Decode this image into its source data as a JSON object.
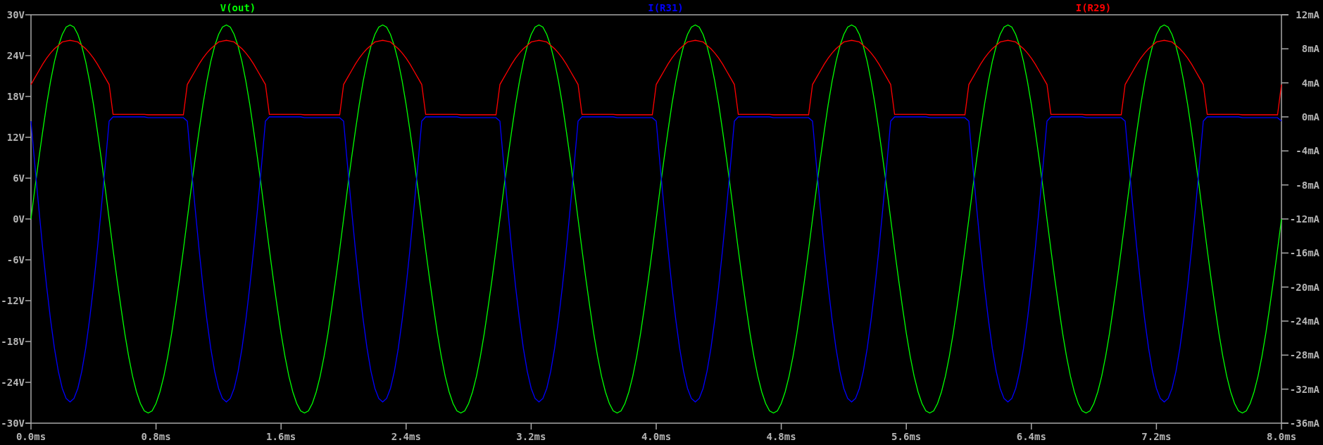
{
  "plot": {
    "chart_data": {
      "type": "line",
      "xlim": [
        0,
        8
      ],
      "ylim": [
        -30,
        30
      ],
      "y2lim": [
        -36,
        12
      ],
      "xticks": [
        {
          "value": 0,
          "label": "0.0ms"
        },
        {
          "value": 0.8,
          "label": "0.8ms"
        },
        {
          "value": 1.6,
          "label": "1.6ms"
        },
        {
          "value": 2.4,
          "label": "2.4ms"
        },
        {
          "value": 3.2,
          "label": "3.2ms"
        },
        {
          "value": 4,
          "label": "4.0ms"
        },
        {
          "value": 4.8,
          "label": "4.8ms"
        },
        {
          "value": 5.6,
          "label": "5.6ms"
        },
        {
          "value": 6.4,
          "label": "6.4ms"
        },
        {
          "value": 7.2,
          "label": "7.2ms"
        },
        {
          "value": 8,
          "label": "8.0ms"
        }
      ],
      "yticks": [
        {
          "value": 30,
          "label": "30V"
        },
        {
          "value": 24,
          "label": "24V"
        },
        {
          "value": 18,
          "label": "18V"
        },
        {
          "value": 12,
          "label": "12V"
        },
        {
          "value": 6,
          "label": "6V"
        },
        {
          "value": 0,
          "label": "0V"
        },
        {
          "value": -6,
          "label": "-6V"
        },
        {
          "value": -12,
          "label": "-12V"
        },
        {
          "value": -18,
          "label": "-18V"
        },
        {
          "value": -24,
          "label": "-24V"
        },
        {
          "value": -30,
          "label": "-30V"
        }
      ],
      "y2ticks": [
        {
          "value": 12,
          "label": "12mA"
        },
        {
          "value": 8,
          "label": "8mA"
        },
        {
          "value": 4,
          "label": "4mA"
        },
        {
          "value": 0,
          "label": "0mA"
        },
        {
          "value": -4,
          "label": "-4mA"
        },
        {
          "value": -8,
          "label": "-8mA"
        },
        {
          "value": -12,
          "label": "-12mA"
        },
        {
          "value": -16,
          "label": "-16mA"
        },
        {
          "value": -20,
          "label": "-20mA"
        },
        {
          "value": -24,
          "label": "-24mA"
        },
        {
          "value": -28,
          "label": "-28mA"
        },
        {
          "value": -32,
          "label": "-32mA"
        },
        {
          "value": -36,
          "label": "-36mA"
        }
      ],
      "x": [
        0,
        0.025,
        0.05,
        0.075,
        0.1,
        0.125,
        0.15,
        0.175,
        0.2,
        0.225,
        0.25,
        0.275,
        0.3,
        0.325,
        0.35,
        0.375,
        0.4,
        0.425,
        0.45,
        0.475,
        0.5,
        0.525,
        0.55,
        0.575,
        0.6,
        0.625,
        0.65,
        0.675,
        0.7,
        0.725,
        0.75,
        0.775,
        0.8,
        0.825,
        0.85,
        0.875,
        0.9,
        0.925,
        0.95,
        0.975,
        1,
        1.025,
        1.05,
        1.075,
        1.1,
        1.125,
        1.15,
        1.175,
        1.2,
        1.225,
        1.25,
        1.275,
        1.3,
        1.325,
        1.35,
        1.375,
        1.4,
        1.425,
        1.45,
        1.475,
        1.5,
        1.525,
        1.55,
        1.575,
        1.6,
        1.625,
        1.65,
        1.675,
        1.7,
        1.725,
        1.75,
        1.775,
        1.8,
        1.825,
        1.85,
        1.875,
        1.9,
        1.925,
        1.95,
        1.975,
        2,
        2.025,
        2.05,
        2.075,
        2.1,
        2.125,
        2.15,
        2.175,
        2.2,
        2.225,
        2.25,
        2.275,
        2.3,
        2.325,
        2.35,
        2.375,
        2.4,
        2.425,
        2.45,
        2.475,
        2.5,
        2.525,
        2.55,
        2.575,
        2.6,
        2.625,
        2.65,
        2.675,
        2.7,
        2.725,
        2.75,
        2.775,
        2.8,
        2.825,
        2.85,
        2.875,
        2.9,
        2.925,
        2.95,
        2.975,
        3,
        3.025,
        3.05,
        3.075,
        3.1,
        3.125,
        3.15,
        3.175,
        3.2,
        3.225,
        3.25,
        3.275,
        3.3,
        3.325,
        3.35,
        3.375,
        3.4,
        3.425,
        3.45,
        3.475,
        3.5,
        3.525,
        3.55,
        3.575,
        3.6,
        3.625,
        3.65,
        3.675,
        3.7,
        3.725,
        3.75,
        3.775,
        3.8,
        3.825,
        3.85,
        3.875,
        3.9,
        3.925,
        3.95,
        3.975,
        4,
        4.025,
        4.05,
        4.075,
        4.1,
        4.125,
        4.15,
        4.175,
        4.2,
        4.225,
        4.25,
        4.275,
        4.3,
        4.325,
        4.35,
        4.375,
        4.4,
        4.425,
        4.45,
        4.475,
        4.5,
        4.525,
        4.55,
        4.575,
        4.6,
        4.625,
        4.65,
        4.675,
        4.7,
        4.725,
        4.75,
        4.775,
        4.8,
        4.825,
        4.85,
        4.875,
        4.9,
        4.925,
        4.95,
        4.975,
        5,
        5.025,
        5.05,
        5.075,
        5.1,
        5.125,
        5.15,
        5.175,
        5.2,
        5.225,
        5.25,
        5.275,
        5.3,
        5.325,
        5.35,
        5.375,
        5.4,
        5.425,
        5.45,
        5.475,
        5.5,
        5.525,
        5.55,
        5.575,
        5.6,
        5.625,
        5.65,
        5.675,
        5.7,
        5.725,
        5.75,
        5.775,
        5.8,
        5.825,
        5.85,
        5.875,
        5.9,
        5.925,
        5.95,
        5.975,
        6,
        6.025,
        6.05,
        6.075,
        6.1,
        6.125,
        6.15,
        6.175,
        6.2,
        6.225,
        6.25,
        6.275,
        6.3,
        6.325,
        6.35,
        6.375,
        6.4,
        6.425,
        6.45,
        6.475,
        6.5,
        6.525,
        6.55,
        6.575,
        6.6,
        6.625,
        6.65,
        6.675,
        6.7,
        6.725,
        6.75,
        6.775,
        6.8,
        6.825,
        6.85,
        6.875,
        6.9,
        6.925,
        6.95,
        6.975,
        7,
        7.025,
        7.05,
        7.075,
        7.1,
        7.125,
        7.15,
        7.175,
        7.2,
        7.225,
        7.25,
        7.275,
        7.3,
        7.325,
        7.35,
        7.375,
        7.4,
        7.425,
        7.45,
        7.475,
        7.5,
        7.525,
        7.55,
        7.575,
        7.6,
        7.625,
        7.65,
        7.675,
        7.7,
        7.725,
        7.75,
        7.775,
        7.8,
        7.825,
        7.85,
        7.875,
        7.9,
        7.925,
        7.95,
        7.975,
        8
      ],
      "series": [
        {
          "name": "V(out)",
          "color": "#00ff00",
          "axis": "y",
          "values": [
            0,
            4.5,
            8.8,
            12.9,
            16.8,
            20.2,
            23.1,
            25.4,
            27.1,
            28.2,
            28.5,
            28.2,
            27.1,
            25.4,
            23.1,
            20.2,
            16.8,
            12.9,
            8.8,
            4.5,
            0,
            -4.5,
            -8.8,
            -12.9,
            -16.8,
            -20.2,
            -23.1,
            -25.4,
            -27.1,
            -28.2,
            -28.5,
            -28.2,
            -27.1,
            -25.4,
            -23.1,
            -20.2,
            -16.8,
            -12.9,
            -8.8,
            -4.5,
            0,
            4.5,
            8.8,
            12.9,
            16.8,
            20.2,
            23.1,
            25.4,
            27.1,
            28.2,
            28.5,
            28.2,
            27.1,
            25.4,
            23.1,
            20.2,
            16.8,
            12.9,
            8.8,
            4.5,
            0,
            -4.5,
            -8.8,
            -12.9,
            -16.8,
            -20.2,
            -23.1,
            -25.4,
            -27.1,
            -28.2,
            -28.5,
            -28.2,
            -27.1,
            -25.4,
            -23.1,
            -20.2,
            -16.8,
            -12.9,
            -8.8,
            -4.5,
            0,
            4.5,
            8.8,
            12.9,
            16.8,
            20.2,
            23.1,
            25.4,
            27.1,
            28.2,
            28.5,
            28.2,
            27.1,
            25.4,
            23.1,
            20.2,
            16.8,
            12.9,
            8.8,
            4.5,
            0,
            -4.5,
            -8.8,
            -12.9,
            -16.8,
            -20.2,
            -23.1,
            -25.4,
            -27.1,
            -28.2,
            -28.5,
            -28.2,
            -27.1,
            -25.4,
            -23.1,
            -20.2,
            -16.8,
            -12.9,
            -8.8,
            -4.5,
            0,
            4.5,
            8.8,
            12.9,
            16.8,
            20.2,
            23.1,
            25.4,
            27.1,
            28.2,
            28.5,
            28.2,
            27.1,
            25.4,
            23.1,
            20.2,
            16.8,
            12.9,
            8.8,
            4.5,
            0,
            -4.5,
            -8.8,
            -12.9,
            -16.8,
            -20.2,
            -23.1,
            -25.4,
            -27.1,
            -28.2,
            -28.5,
            -28.2,
            -27.1,
            -25.4,
            -23.1,
            -20.2,
            -16.8,
            -12.9,
            -8.8,
            -4.5,
            0,
            4.5,
            8.8,
            12.9,
            16.8,
            20.2,
            23.1,
            25.4,
            27.1,
            28.2,
            28.5,
            28.2,
            27.1,
            25.4,
            23.1,
            20.2,
            16.8,
            12.9,
            8.8,
            4.5,
            0,
            -4.5,
            -8.8,
            -12.9,
            -16.8,
            -20.2,
            -23.1,
            -25.4,
            -27.1,
            -28.2,
            -28.5,
            -28.2,
            -27.1,
            -25.4,
            -23.1,
            -20.2,
            -16.8,
            -12.9,
            -8.8,
            -4.5,
            0,
            4.5,
            8.8,
            12.9,
            16.8,
            20.2,
            23.1,
            25.4,
            27.1,
            28.2,
            28.5,
            28.2,
            27.1,
            25.4,
            23.1,
            20.2,
            16.8,
            12.9,
            8.8,
            4.5,
            0,
            -4.5,
            -8.8,
            -12.9,
            -16.8,
            -20.2,
            -23.1,
            -25.4,
            -27.1,
            -28.2,
            -28.5,
            -28.2,
            -27.1,
            -25.4,
            -23.1,
            -20.2,
            -16.8,
            -12.9,
            -8.8,
            -4.5,
            0,
            4.5,
            8.8,
            12.9,
            16.8,
            20.2,
            23.1,
            25.4,
            27.1,
            28.2,
            28.5,
            28.2,
            27.1,
            25.4,
            23.1,
            20.2,
            16.8,
            12.9,
            8.8,
            4.5,
            0,
            -4.5,
            -8.8,
            -12.9,
            -16.8,
            -20.2,
            -23.1,
            -25.4,
            -27.1,
            -28.2,
            -28.5,
            -28.2,
            -27.1,
            -25.4,
            -23.1,
            -20.2,
            -16.8,
            -12.9,
            -8.8,
            -4.5,
            0,
            4.5,
            8.8,
            12.9,
            16.8,
            20.2,
            23.1,
            25.4,
            27.1,
            28.2,
            28.5,
            28.2,
            27.1,
            25.4,
            23.1,
            20.2,
            16.8,
            12.9,
            8.8,
            4.5,
            0,
            -4.5,
            -8.8,
            -12.9,
            -16.8,
            -20.2,
            -23.1,
            -25.4,
            -27.1,
            -28.2,
            -28.5,
            -28.2,
            -27.1,
            -25.4,
            -23.1,
            -20.2,
            -16.8,
            -12.9,
            -8.8,
            -4.5,
            0
          ]
        },
        {
          "name": "I(R31)",
          "color": "#0000ff",
          "axis": "y2",
          "values": [
            -0.5,
            -5.7,
            -10.7,
            -15.5,
            -19.9,
            -23.8,
            -27.2,
            -29.9,
            -31.9,
            -33.1,
            -33.5,
            -33.1,
            -31.9,
            -29.9,
            -27.2,
            -23.8,
            -19.9,
            -15.5,
            -10.7,
            -5.7,
            -0.5,
            0,
            0,
            0,
            0,
            0,
            0,
            0,
            0,
            0,
            -0.1,
            -0.1,
            -0.1,
            -0.1,
            -0.1,
            -0.1,
            -0.1,
            -0.1,
            -0.1,
            -0.1,
            -0.5,
            -5.7,
            -10.7,
            -15.5,
            -19.9,
            -23.8,
            -27.2,
            -29.9,
            -31.9,
            -33.1,
            -33.5,
            -33.1,
            -31.9,
            -29.9,
            -27.2,
            -23.8,
            -19.9,
            -15.5,
            -10.7,
            -5.7,
            -0.5,
            0,
            0,
            0,
            0,
            0,
            0,
            0,
            0,
            0,
            -0.1,
            -0.1,
            -0.1,
            -0.1,
            -0.1,
            -0.1,
            -0.1,
            -0.1,
            -0.1,
            -0.1,
            -0.5,
            -5.7,
            -10.7,
            -15.5,
            -19.9,
            -23.8,
            -27.2,
            -29.9,
            -31.9,
            -33.1,
            -33.5,
            -33.1,
            -31.9,
            -29.9,
            -27.2,
            -23.8,
            -19.9,
            -15.5,
            -10.7,
            -5.7,
            -0.5,
            0,
            0,
            0,
            0,
            0,
            0,
            0,
            0,
            0,
            -0.1,
            -0.1,
            -0.1,
            -0.1,
            -0.1,
            -0.1,
            -0.1,
            -0.1,
            -0.1,
            -0.1,
            -0.5,
            -5.7,
            -10.7,
            -15.5,
            -19.9,
            -23.8,
            -27.2,
            -29.9,
            -31.9,
            -33.1,
            -33.5,
            -33.1,
            -31.9,
            -29.9,
            -27.2,
            -23.8,
            -19.9,
            -15.5,
            -10.7,
            -5.7,
            -0.5,
            0,
            0,
            0,
            0,
            0,
            0,
            0,
            0,
            0,
            -0.1,
            -0.1,
            -0.1,
            -0.1,
            -0.1,
            -0.1,
            -0.1,
            -0.1,
            -0.1,
            -0.1,
            -0.5,
            -5.7,
            -10.7,
            -15.5,
            -19.9,
            -23.8,
            -27.2,
            -29.9,
            -31.9,
            -33.1,
            -33.5,
            -33.1,
            -31.9,
            -29.9,
            -27.2,
            -23.8,
            -19.9,
            -15.5,
            -10.7,
            -5.7,
            -0.5,
            0,
            0,
            0,
            0,
            0,
            0,
            0,
            0,
            0,
            -0.1,
            -0.1,
            -0.1,
            -0.1,
            -0.1,
            -0.1,
            -0.1,
            -0.1,
            -0.1,
            -0.1,
            -0.5,
            -5.7,
            -10.7,
            -15.5,
            -19.9,
            -23.8,
            -27.2,
            -29.9,
            -31.9,
            -33.1,
            -33.5,
            -33.1,
            -31.9,
            -29.9,
            -27.2,
            -23.8,
            -19.9,
            -15.5,
            -10.7,
            -5.7,
            -0.5,
            0,
            0,
            0,
            0,
            0,
            0,
            0,
            0,
            0,
            -0.1,
            -0.1,
            -0.1,
            -0.1,
            -0.1,
            -0.1,
            -0.1,
            -0.1,
            -0.1,
            -0.1,
            -0.5,
            -5.7,
            -10.7,
            -15.5,
            -19.9,
            -23.8,
            -27.2,
            -29.9,
            -31.9,
            -33.1,
            -33.5,
            -33.1,
            -31.9,
            -29.9,
            -27.2,
            -23.8,
            -19.9,
            -15.5,
            -10.7,
            -5.7,
            -0.5,
            0,
            0,
            0,
            0,
            0,
            0,
            0,
            0,
            0,
            -0.1,
            -0.1,
            -0.1,
            -0.1,
            -0.1,
            -0.1,
            -0.1,
            -0.1,
            -0.1,
            -0.1,
            -0.5,
            -5.7,
            -10.7,
            -15.5,
            -19.9,
            -23.8,
            -27.2,
            -29.9,
            -31.9,
            -33.1,
            -33.5,
            -33.1,
            -31.9,
            -29.9,
            -27.2,
            -23.8,
            -19.9,
            -15.5,
            -10.7,
            -5.7,
            -0.5,
            0,
            0,
            0,
            0,
            0,
            0,
            0,
            0,
            0,
            -0.1,
            -0.1,
            -0.1,
            -0.1,
            -0.1,
            -0.1,
            -0.1,
            -0.1,
            -0.1,
            -0.1,
            -0.5
          ]
        },
        {
          "name": "I(R29)",
          "color": "#ff0000",
          "axis": "y2",
          "values": [
            3.8,
            4.6,
            5.4,
            6.2,
            6.9,
            7.5,
            8,
            8.4,
            8.8,
            8.9,
            9,
            8.9,
            8.8,
            8.4,
            8,
            7.5,
            6.9,
            6.2,
            5.4,
            4.6,
            3.8,
            0.3,
            0.3,
            0.3,
            0.3,
            0.3,
            0.3,
            0.3,
            0.3,
            0.3,
            0.25,
            0.25,
            0.25,
            0.25,
            0.25,
            0.25,
            0.25,
            0.25,
            0.25,
            0.25,
            3.8,
            4.6,
            5.4,
            6.2,
            6.9,
            7.5,
            8,
            8.4,
            8.8,
            8.9,
            9,
            8.9,
            8.8,
            8.4,
            8,
            7.5,
            6.9,
            6.2,
            5.4,
            4.6,
            3.8,
            0.3,
            0.3,
            0.3,
            0.3,
            0.3,
            0.3,
            0.3,
            0.3,
            0.3,
            0.25,
            0.25,
            0.25,
            0.25,
            0.25,
            0.25,
            0.25,
            0.25,
            0.25,
            0.25,
            3.8,
            4.6,
            5.4,
            6.2,
            6.9,
            7.5,
            8,
            8.4,
            8.8,
            8.9,
            9,
            8.9,
            8.8,
            8.4,
            8,
            7.5,
            6.9,
            6.2,
            5.4,
            4.6,
            3.8,
            0.3,
            0.3,
            0.3,
            0.3,
            0.3,
            0.3,
            0.3,
            0.3,
            0.3,
            0.25,
            0.25,
            0.25,
            0.25,
            0.25,
            0.25,
            0.25,
            0.25,
            0.25,
            0.25,
            3.8,
            4.6,
            5.4,
            6.2,
            6.9,
            7.5,
            8,
            8.4,
            8.8,
            8.9,
            9,
            8.9,
            8.8,
            8.4,
            8,
            7.5,
            6.9,
            6.2,
            5.4,
            4.6,
            3.8,
            0.3,
            0.3,
            0.3,
            0.3,
            0.3,
            0.3,
            0.3,
            0.3,
            0.3,
            0.25,
            0.25,
            0.25,
            0.25,
            0.25,
            0.25,
            0.25,
            0.25,
            0.25,
            0.25,
            3.8,
            4.6,
            5.4,
            6.2,
            6.9,
            7.5,
            8,
            8.4,
            8.8,
            8.9,
            9,
            8.9,
            8.8,
            8.4,
            8,
            7.5,
            6.9,
            6.2,
            5.4,
            4.6,
            3.8,
            0.3,
            0.3,
            0.3,
            0.3,
            0.3,
            0.3,
            0.3,
            0.3,
            0.3,
            0.25,
            0.25,
            0.25,
            0.25,
            0.25,
            0.25,
            0.25,
            0.25,
            0.25,
            0.25,
            3.8,
            4.6,
            5.4,
            6.2,
            6.9,
            7.5,
            8,
            8.4,
            8.8,
            8.9,
            9,
            8.9,
            8.8,
            8.4,
            8,
            7.5,
            6.9,
            6.2,
            5.4,
            4.6,
            3.8,
            0.3,
            0.3,
            0.3,
            0.3,
            0.3,
            0.3,
            0.3,
            0.3,
            0.3,
            0.25,
            0.25,
            0.25,
            0.25,
            0.25,
            0.25,
            0.25,
            0.25,
            0.25,
            0.25,
            3.8,
            4.6,
            5.4,
            6.2,
            6.9,
            7.5,
            8,
            8.4,
            8.8,
            8.9,
            9,
            8.9,
            8.8,
            8.4,
            8,
            7.5,
            6.9,
            6.2,
            5.4,
            4.6,
            3.8,
            0.3,
            0.3,
            0.3,
            0.3,
            0.3,
            0.3,
            0.3,
            0.3,
            0.3,
            0.25,
            0.25,
            0.25,
            0.25,
            0.25,
            0.25,
            0.25,
            0.25,
            0.25,
            0.25,
            3.8,
            4.6,
            5.4,
            6.2,
            6.9,
            7.5,
            8,
            8.4,
            8.8,
            8.9,
            9,
            8.9,
            8.8,
            8.4,
            8,
            7.5,
            6.9,
            6.2,
            5.4,
            4.6,
            3.8,
            0.3,
            0.3,
            0.3,
            0.3,
            0.3,
            0.3,
            0.3,
            0.3,
            0.3,
            0.25,
            0.25,
            0.25,
            0.25,
            0.25,
            0.25,
            0.25,
            0.25,
            0.25,
            0.25,
            3.8
          ]
        }
      ]
    }
  }
}
